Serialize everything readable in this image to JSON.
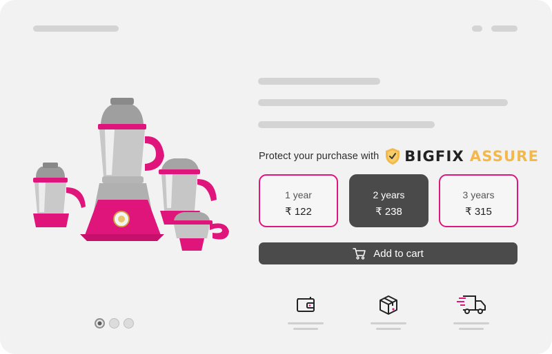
{
  "protection": {
    "prefix_text": "Protect your purchase with",
    "brand_primary": "BIGFIX",
    "brand_secondary": "ASSURE",
    "plans": [
      {
        "term": "1 year",
        "price": "₹ 122",
        "selected": false
      },
      {
        "term": "2 years",
        "price": "₹ 238",
        "selected": true
      },
      {
        "term": "3 years",
        "price": "₹ 315",
        "selected": false
      }
    ]
  },
  "cart": {
    "label": "Add to cart"
  },
  "carousel": {
    "count": 3,
    "active_index": 0
  },
  "features": [
    "wallet-icon",
    "package-icon",
    "delivery-truck-icon"
  ],
  "colors": {
    "accent": "#e0157c",
    "brand_gold": "#f2b84b",
    "dark": "#4a4a4a",
    "background": "#f2f2f2"
  }
}
